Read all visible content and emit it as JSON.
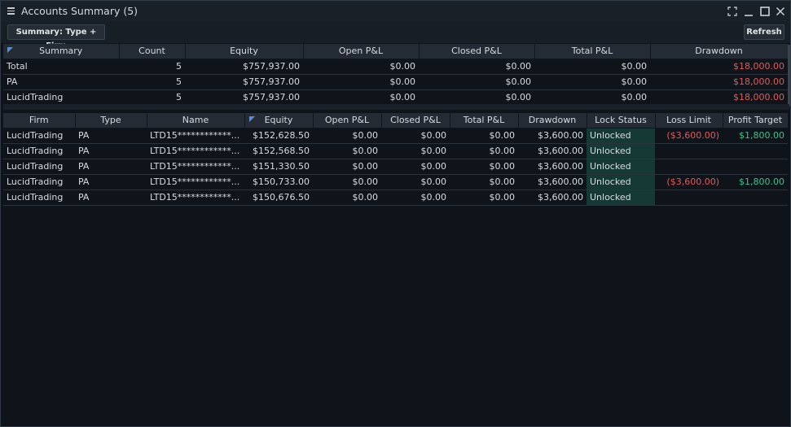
{
  "window": {
    "title": "Accounts Summary (5)"
  },
  "toolbar": {
    "summary_label": "Summary: Type + Firm",
    "refresh_label": "Refresh"
  },
  "summary": {
    "columns": [
      "Summary",
      "Count",
      "Equity",
      "Open P&L",
      "Closed P&L",
      "Total P&L",
      "Drawdown"
    ],
    "rows": [
      {
        "name": "Total",
        "count": "5",
        "equity": "$757,937.00",
        "open": "$0.00",
        "closed": "$0.00",
        "total": "$0.00",
        "drawdown": "$18,000.00"
      },
      {
        "name": "PA",
        "count": "5",
        "equity": "$757,937.00",
        "open": "$0.00",
        "closed": "$0.00",
        "total": "$0.00",
        "drawdown": "$18,000.00"
      },
      {
        "name": "LucidTrading",
        "count": "5",
        "equity": "$757,937.00",
        "open": "$0.00",
        "closed": "$0.00",
        "total": "$0.00",
        "drawdown": "$18,000.00"
      }
    ]
  },
  "accounts": {
    "columns": [
      "Firm",
      "Type",
      "Name",
      "Equity",
      "Open P&L",
      "Closed P&L",
      "Total P&L",
      "Drawdown",
      "Lock Status",
      "Loss Limit",
      "Profit Target"
    ],
    "rows": [
      {
        "firm": "LucidTrading",
        "type": "PA",
        "name": "LTD15************...",
        "equity": "$152,628.50",
        "open": "$0.00",
        "closed": "$0.00",
        "total": "$0.00",
        "drawdown": "$3,600.00",
        "lock": "Unlocked",
        "loss_limit": "($3,600.00)",
        "profit_target": "$1,800.00"
      },
      {
        "firm": "LucidTrading",
        "type": "PA",
        "name": "LTD15************...",
        "equity": "$152,568.50",
        "open": "$0.00",
        "closed": "$0.00",
        "total": "$0.00",
        "drawdown": "$3,600.00",
        "lock": "Unlocked",
        "loss_limit": "",
        "profit_target": ""
      },
      {
        "firm": "LucidTrading",
        "type": "PA",
        "name": "LTD15************...",
        "equity": "$151,330.50",
        "open": "$0.00",
        "closed": "$0.00",
        "total": "$0.00",
        "drawdown": "$3,600.00",
        "lock": "Unlocked",
        "loss_limit": "",
        "profit_target": ""
      },
      {
        "firm": "LucidTrading",
        "type": "PA",
        "name": "LTD15************...",
        "equity": "$150,733.00",
        "open": "$0.00",
        "closed": "$0.00",
        "total": "$0.00",
        "drawdown": "$3,600.00",
        "lock": "Unlocked",
        "loss_limit": "($3,600.00)",
        "profit_target": "$1,800.00"
      },
      {
        "firm": "LucidTrading",
        "type": "PA",
        "name": "LTD15************...",
        "equity": "$150,676.50",
        "open": "$0.00",
        "closed": "$0.00",
        "total": "$0.00",
        "drawdown": "$3,600.00",
        "lock": "Unlocked",
        "loss_limit": "",
        "profit_target": ""
      }
    ]
  },
  "colors": {
    "negative": "#e05a5a",
    "positive": "#3cc28a",
    "lock_cell_bg": "#153a36",
    "header_bg": "#242b34"
  },
  "icons": {
    "menu": "hamburger-icon",
    "maximize_view": "expand-corners-icon",
    "minimize": "minimize-icon",
    "maximize": "maximize-icon",
    "close": "close-icon"
  }
}
